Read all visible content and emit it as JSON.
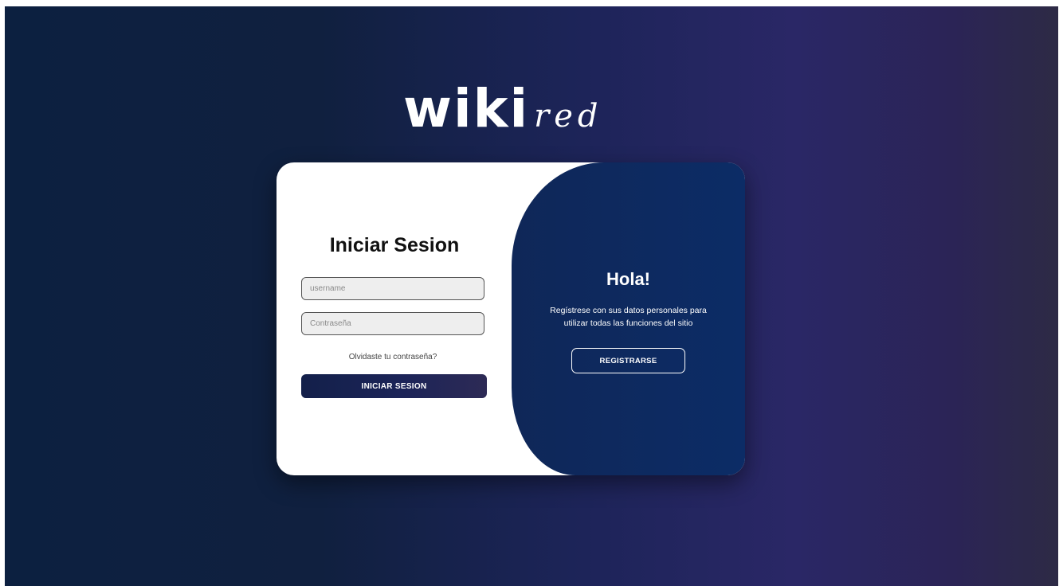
{
  "brand": {
    "logo_main": "wiki",
    "logo_sub": "red"
  },
  "login": {
    "title": "Iniciar Sesion",
    "username_placeholder": "username",
    "password_placeholder": "Contraseña",
    "forgot_label": "Olvidaste tu contraseña?",
    "submit_label": "INICIAR SESION"
  },
  "register": {
    "title": "Hola!",
    "line1": "Regístrese con sus datos personales para",
    "line2": "utilizar todas las funciones del sitio",
    "button_label": "REGISTRARSE"
  },
  "colors": {
    "background_left": "#0c2040",
    "background_right": "#2b2456",
    "panel_blue": "#0c2c66",
    "button_dark": "#1c2458"
  }
}
